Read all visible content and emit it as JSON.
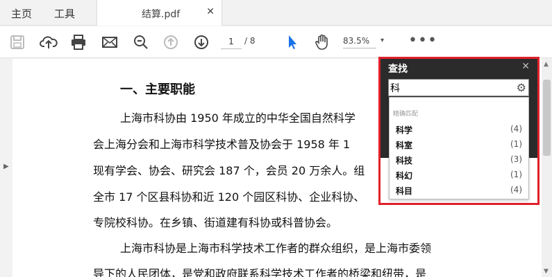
{
  "tabs": {
    "home": "主页",
    "tools": "工具",
    "document": "结算.pdf",
    "close": "✕"
  },
  "toolbar": {
    "page_current": "1",
    "page_total": "/ 8",
    "zoom": "83.5%",
    "zoom_arrow": "▾",
    "more": "•••",
    "accent_color": "#1a73e8"
  },
  "document": {
    "heading": "一、主要职能",
    "lines": [
      "上海市科协由  1950  年成立的中华全国自然科学",
      "会上海分会和上海市科学技术普及协会于 1958 年 1",
      "现有学会、协会、研究会 187 个，会员 20 万余人。组",
      "全市 17 个区县科协和近 120 个园区科协、企业科协、",
      "专院校科协。在乡镇、街道建有科协或科普协会。",
      "上海市科协是上海市科学技术工作者的群众组织，是上海市委领",
      "导下的人民团体，是党和政府联系科学技术工作者的桥梁和纽带，是"
    ]
  },
  "find": {
    "title": "查找",
    "close": "✕",
    "query": "科",
    "settings_icon": "⚙",
    "suggest_header": "精确匹配",
    "results": [
      {
        "term": "科学",
        "count": "(4)"
      },
      {
        "term": "科室",
        "count": "(1)"
      },
      {
        "term": "科技",
        "count": "(3)"
      },
      {
        "term": "科幻",
        "count": "(1)"
      },
      {
        "term": "科目",
        "count": "(4)"
      }
    ],
    "highlight_color": "#e0202a"
  }
}
